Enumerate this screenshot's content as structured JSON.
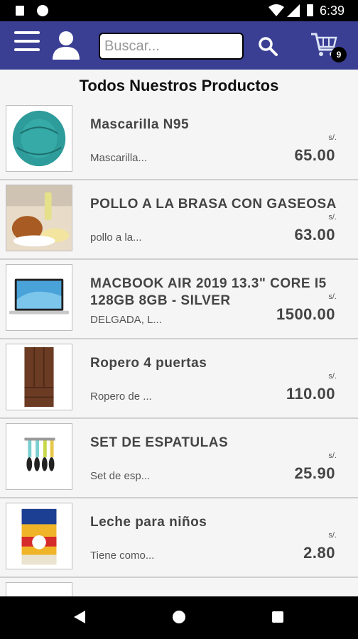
{
  "status_bar": {
    "time": "6:39"
  },
  "app_bar": {
    "search_placeholder": "Buscar...",
    "cart_count": "9",
    "color": "#3a3f94"
  },
  "heading": "Todos Nuestros Productos",
  "products": [
    {
      "name": "Mascarilla N95",
      "desc": "Mascarilla...",
      "currency": "s/.",
      "price": "65.00",
      "icon": "n95-mask-image"
    },
    {
      "name": "POLLO A LA BRASA CON GASEOSA",
      "desc": "pollo a la...",
      "currency": "s/.",
      "price": "63.00",
      "icon": "roast-chicken-image"
    },
    {
      "name": "MACBOOK AIR 2019 13.3\" CORE I5 128GB 8GB - SILVER",
      "desc": "DELGADA, L...",
      "currency": "s/.",
      "price": "1500.00",
      "icon": "laptop-image"
    },
    {
      "name": "Ropero 4 puertas",
      "desc": "Ropero de ...",
      "currency": "s/.",
      "price": "110.00",
      "icon": "wardrobe-image"
    },
    {
      "name": "SET DE ESPATULAS",
      "desc": "Set de esp...",
      "currency": "s/.",
      "price": "25.90",
      "icon": "spatula-set-image"
    },
    {
      "name": "Leche para niños",
      "desc": "Tiene como...",
      "currency": "s/.",
      "price": "2.80",
      "icon": "milk-can-image"
    }
  ]
}
